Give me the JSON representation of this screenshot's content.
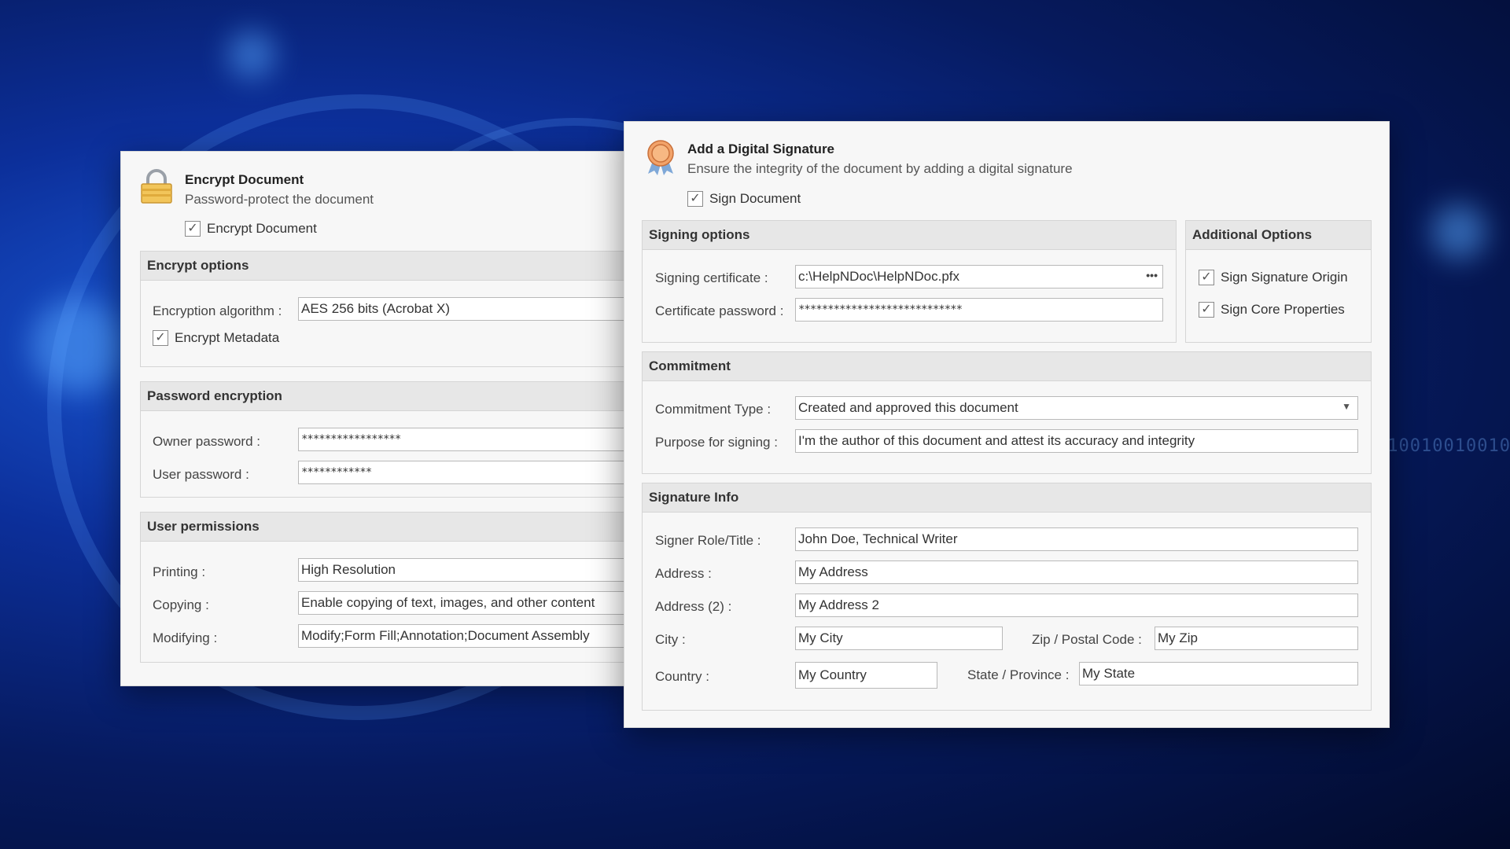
{
  "encrypt_panel": {
    "title": "Encrypt Document",
    "subtitle": "Password-protect the document",
    "icon": "lock-icon",
    "encrypt_checkbox": {
      "label": "Encrypt Document",
      "checked": true
    },
    "encrypt_options": {
      "header": "Encrypt options",
      "algorithm_label": "Encryption algorithm :",
      "algorithm_value": "AES 256 bits (Acrobat X)",
      "metadata_checkbox": {
        "label": "Encrypt Metadata",
        "checked": true
      }
    },
    "password_encryption": {
      "header": "Password encryption",
      "owner_label": "Owner password :",
      "owner_value": "*****************",
      "user_label": "User password :",
      "user_value": "************"
    },
    "user_permissions": {
      "header": "User permissions",
      "printing_label": "Printing :",
      "printing_value": "High Resolution",
      "copying_label": "Copying :",
      "copying_value": "Enable copying of text, images, and other content",
      "modifying_label": "Modifying :",
      "modifying_value": "Modify;Form Fill;Annotation;Document Assembly"
    }
  },
  "signature_panel": {
    "title": "Add a Digital Signature",
    "subtitle": "Ensure the integrity of the document by adding a digital signature",
    "icon": "certificate-badge-icon",
    "sign_checkbox": {
      "label": "Sign Document",
      "checked": true
    },
    "signing_options": {
      "header": "Signing options",
      "certificate_label": "Signing certificate :",
      "certificate_value": "c:\\HelpNDoc\\HelpNDoc.pfx",
      "browse_glyph": "•••",
      "password_label": "Certificate password :",
      "password_value": "****************************"
    },
    "additional_options": {
      "header": "Additional Options",
      "sign_origin": {
        "label": "Sign Signature Origin",
        "checked": true
      },
      "sign_core": {
        "label": "Sign Core Properties",
        "checked": true
      }
    },
    "commitment": {
      "header": "Commitment",
      "type_label": "Commitment Type :",
      "type_value": "Created and approved this document",
      "purpose_label": "Purpose for signing :",
      "purpose_value": "I'm the author of this document and attest its accuracy and integrity"
    },
    "signature_info": {
      "header": "Signature Info",
      "role_label": "Signer Role/Title :",
      "role_value": "John Doe, Technical Writer",
      "address_label": "Address :",
      "address_value": "My Address",
      "address2_label": "Address (2) :",
      "address2_value": "My Address 2",
      "city_label": "City :",
      "city_value": "My City",
      "zip_label": "Zip / Postal Code :",
      "zip_value": "My Zip",
      "country_label": "Country :",
      "country_value": "My Country",
      "state_label": "State / Province :",
      "state_value": "My State"
    }
  },
  "colors": {
    "background_blue": "#0c2f9a",
    "panel_bg": "#f7f7f7",
    "group_header_bg": "#e7e7e7",
    "lock_gold": "#e8b84a",
    "badge_orange": "#e8894a"
  }
}
